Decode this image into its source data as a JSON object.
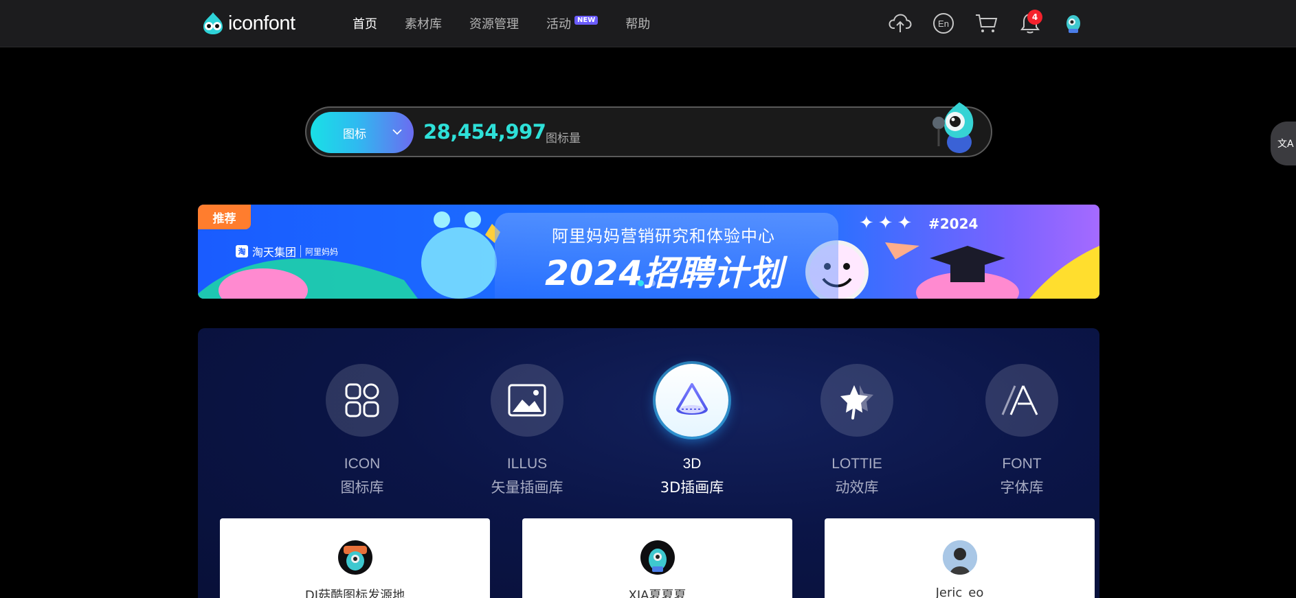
{
  "app": {
    "logo_text": "iconfont"
  },
  "nav": {
    "items": [
      {
        "label": "首页"
      },
      {
        "label": "素材库"
      },
      {
        "label": "资源管理"
      },
      {
        "label": "活动"
      },
      {
        "label": "帮助"
      }
    ],
    "activity_badge": "NEW",
    "lang_icon_label": "En",
    "notification_count": "4"
  },
  "search": {
    "type_label": "图标",
    "count": "28,454,997",
    "count_unit": "图标量"
  },
  "translate_tab_glyph": "文A",
  "banner": {
    "tag": "推荐",
    "brand_name": "淘天集团",
    "brand_box": "淘",
    "partner_name": "阿里妈妈",
    "subtitle": "阿里妈妈营销研究和体验中心",
    "title": "2024招聘计划",
    "hashtag": "#2024",
    "stars": "✦✦✦"
  },
  "categories": [
    {
      "en": "ICON",
      "zh": "图标库",
      "icon": "grid-icon"
    },
    {
      "en": "ILLUS",
      "zh": "矢量插画库",
      "icon": "image-icon"
    },
    {
      "en": "3D",
      "zh": "3D插画库",
      "icon": "cone-icon"
    },
    {
      "en": "LOTTIE",
      "zh": "动效库",
      "icon": "star-motion-icon"
    },
    {
      "en": "FONT",
      "zh": "字体库",
      "icon": "font-a-icon"
    }
  ],
  "featured_cards": [
    {
      "name": "DJ菇酷图标发源地"
    },
    {
      "name": "XIA夏夏夏"
    },
    {
      "name": "Jeric_eo"
    }
  ],
  "colors": {
    "accent_cyan": "#2ee0d8",
    "banner_tag": "#ff7d2e",
    "notification": "#f5222d"
  }
}
